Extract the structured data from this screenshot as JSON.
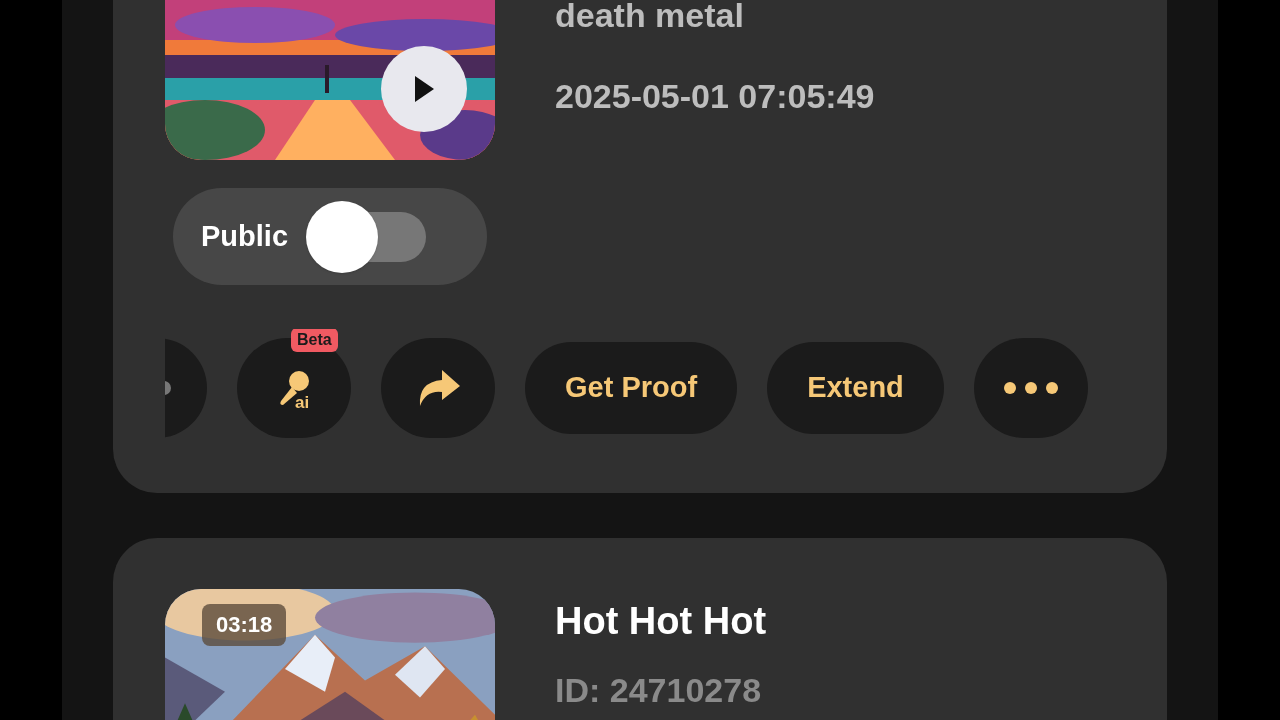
{
  "cards": [
    {
      "style": "death metal",
      "date": "2025-05-01 07:05:49",
      "public_toggle": {
        "label": "Public",
        "on": false
      },
      "actions": [
        {
          "kind": "clipped"
        },
        {
          "kind": "mic",
          "badge": "Beta",
          "sub": "ai"
        },
        {
          "kind": "share"
        },
        {
          "kind": "text",
          "label": "Get Proof"
        },
        {
          "kind": "text",
          "label": "Extend"
        },
        {
          "kind": "more"
        }
      ]
    },
    {
      "title": "Hot Hot Hot",
      "id": "ID: 24710278",
      "duration": "03:18"
    }
  ]
}
